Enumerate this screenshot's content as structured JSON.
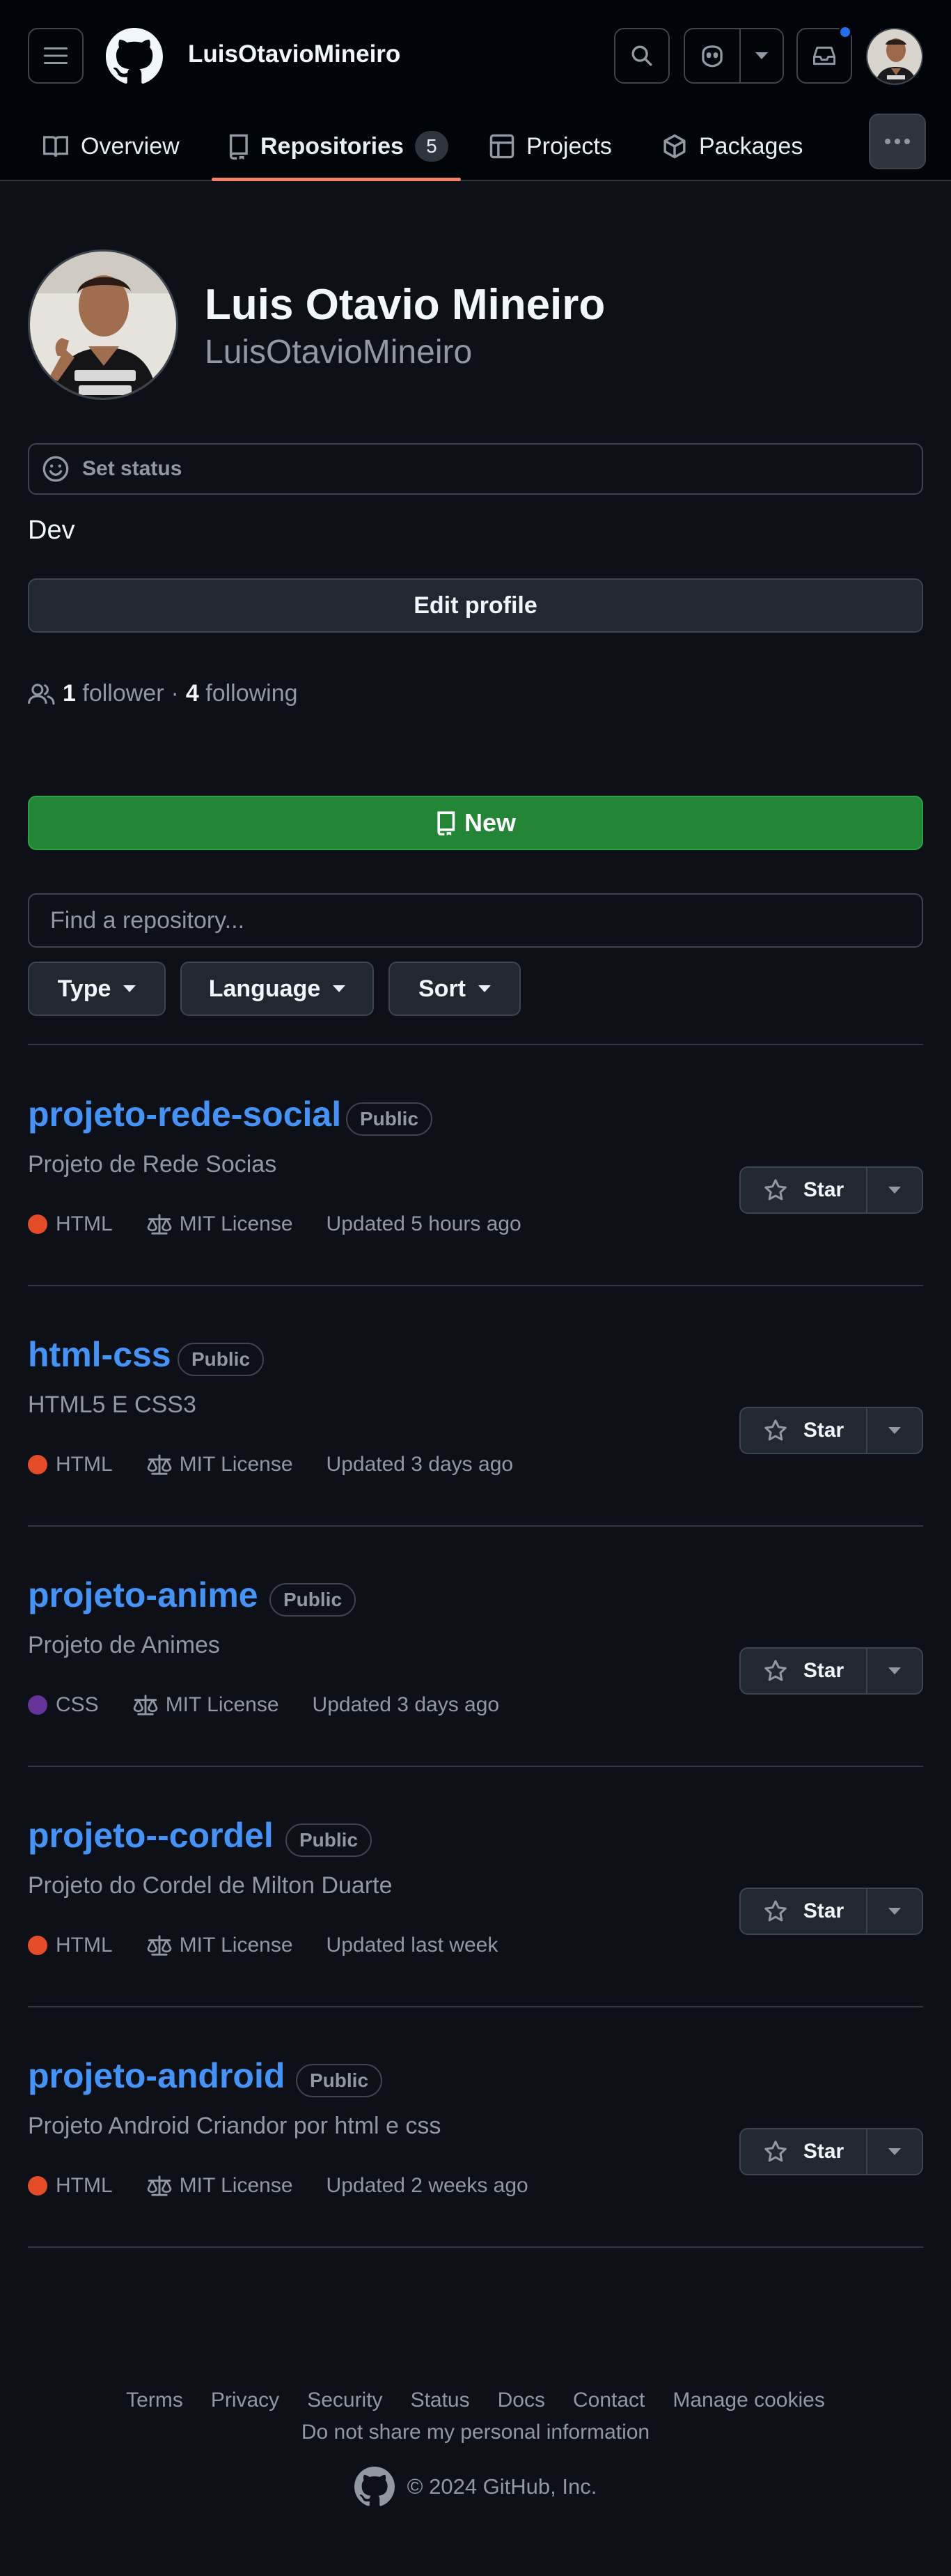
{
  "header": {
    "username": "LuisOtavioMineiro",
    "tabs": [
      {
        "label": "Overview"
      },
      {
        "label": "Repositories",
        "count": "5"
      },
      {
        "label": "Projects"
      },
      {
        "label": "Packages"
      }
    ]
  },
  "profile": {
    "full_name": "Luis Otavio Mineiro",
    "login": "LuisOtavioMineiro",
    "status_label": "Set status",
    "bio": "Dev",
    "edit_label": "Edit profile",
    "followers_count": "1",
    "followers_label": "follower",
    "separator": "·",
    "following_count": "4",
    "following_label": "following"
  },
  "repos_toolbar": {
    "new_label": "New",
    "search_placeholder": "Find a repository...",
    "filters": [
      {
        "label": "Type"
      },
      {
        "label": "Language"
      },
      {
        "label": "Sort"
      }
    ]
  },
  "repositories": [
    {
      "name": "projeto-rede-social",
      "visibility": "Public",
      "description": "Projeto de Rede Socias",
      "language": "HTML",
      "language_color": "#e34c26",
      "license": "MIT License",
      "updated": "Updated 5 hours ago",
      "star_label": "Star"
    },
    {
      "name": "html-css",
      "visibility": "Public",
      "description": "HTML5 E CSS3",
      "language": "HTML",
      "language_color": "#e34c26",
      "license": "MIT License",
      "updated": "Updated 3 days ago",
      "star_label": "Star"
    },
    {
      "name": "projeto-anime",
      "visibility": "Public",
      "description": "Projeto de Animes",
      "language": "CSS",
      "language_color": "#663399",
      "license": "MIT License",
      "updated": "Updated 3 days ago",
      "star_label": "Star"
    },
    {
      "name": "projeto--cordel",
      "visibility": "Public",
      "description": "Projeto do Cordel de Milton Duarte",
      "language": "HTML",
      "language_color": "#e34c26",
      "license": "MIT License",
      "updated": "Updated last week",
      "star_label": "Star"
    },
    {
      "name": "projeto-android",
      "visibility": "Public",
      "description": "Projeto Android Criandor por html e css",
      "language": "HTML",
      "language_color": "#e34c26",
      "license": "MIT License",
      "updated": "Updated 2 weeks ago",
      "star_label": "Star"
    }
  ],
  "footer": {
    "links": [
      "Terms",
      "Privacy",
      "Security",
      "Status",
      "Docs",
      "Contact",
      "Manage cookies"
    ],
    "privacy_link": "Do not share my personal information",
    "copyright": "© 2024 GitHub, Inc."
  },
  "icons": {
    "menu": "hamburger-icon",
    "logo": "github-logo-icon",
    "search": "search-icon",
    "copilot": "copilot-icon",
    "inbox": "inbox-icon",
    "star": "star-icon",
    "law": "law-icon",
    "people": "people-icon",
    "smiley": "smiley-icon",
    "repo": "repo-icon"
  },
  "colors": {
    "accent_link": "#4493f8",
    "tab_underline": "#f78166",
    "new_button": "#238636",
    "notification": "#1f6feb"
  }
}
